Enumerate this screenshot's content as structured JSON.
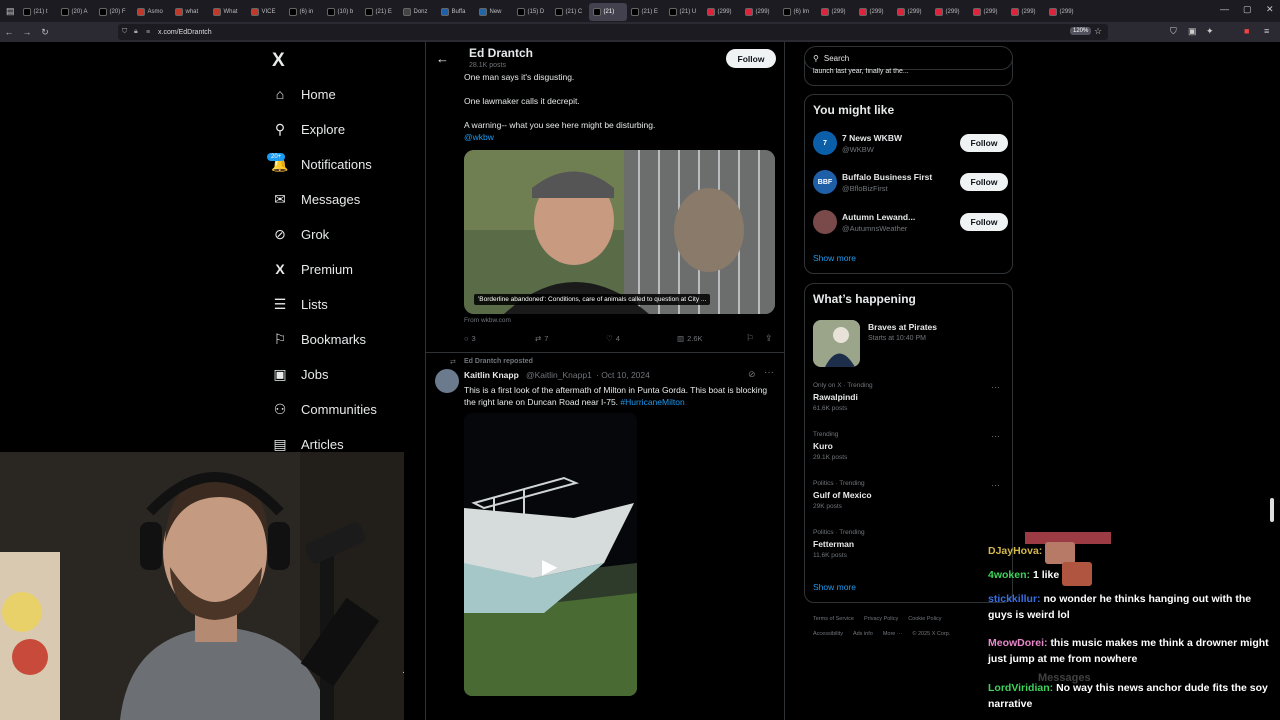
{
  "browser": {
    "tabs": [
      {
        "label": "(21) t",
        "favicon": "x"
      },
      {
        "label": "(20) A",
        "favicon": "x"
      },
      {
        "label": "(20) F",
        "favicon": "x"
      },
      {
        "label": "Asmo",
        "favicon": "o"
      },
      {
        "label": "what",
        "favicon": "o"
      },
      {
        "label": "What",
        "favicon": "o"
      },
      {
        "label": "VICE",
        "favicon": "v"
      },
      {
        "label": "(6) in",
        "favicon": "x"
      },
      {
        "label": "(10) b",
        "favicon": "x"
      },
      {
        "label": "(21) E",
        "favicon": "x"
      },
      {
        "label": "Donz",
        "favicon": "d"
      },
      {
        "label": "Buffa",
        "favicon": "b"
      },
      {
        "label": "New",
        "favicon": "n"
      },
      {
        "label": "(15) D",
        "favicon": "x"
      },
      {
        "label": "(21) C",
        "favicon": "x"
      },
      {
        "label": "(21)",
        "favicon": "x"
      },
      {
        "label": "(21) E",
        "favicon": "x"
      },
      {
        "label": "(21) U",
        "favicon": "x"
      },
      {
        "label": "(299)",
        "favicon": "y"
      },
      {
        "label": "(299)",
        "favicon": "y"
      },
      {
        "label": "(6) Im",
        "favicon": "x"
      },
      {
        "label": "(299)",
        "favicon": "y"
      },
      {
        "label": "(299)",
        "favicon": "y"
      },
      {
        "label": "(299)",
        "favicon": "y"
      },
      {
        "label": "(299)",
        "favicon": "y"
      },
      {
        "label": "(299)",
        "favicon": "y"
      },
      {
        "label": "(299)",
        "favicon": "y"
      },
      {
        "label": "(299)",
        "favicon": "y"
      }
    ],
    "url": "x.com/EdDrantch",
    "zoom": "120%"
  },
  "nav": {
    "items": [
      {
        "label": "Home",
        "icon": "home-icon",
        "glyph": "⌂"
      },
      {
        "label": "Explore",
        "icon": "search-icon",
        "glyph": "⚲"
      },
      {
        "label": "Notifications",
        "icon": "bell-icon",
        "glyph": "🔔"
      },
      {
        "label": "Messages",
        "icon": "mail-icon",
        "glyph": "✉"
      },
      {
        "label": "Grok",
        "icon": "grok-icon",
        "glyph": "⊘"
      },
      {
        "label": "Premium",
        "icon": "x-logo-icon",
        "glyph": "X"
      },
      {
        "label": "Lists",
        "icon": "list-icon",
        "glyph": "☰"
      },
      {
        "label": "Bookmarks",
        "icon": "bookmark-icon",
        "glyph": "⚐"
      },
      {
        "label": "Jobs",
        "icon": "briefcase-icon",
        "glyph": "▣"
      },
      {
        "label": "Communities",
        "icon": "people-icon",
        "glyph": "⚇"
      },
      {
        "label": "Articles",
        "icon": "article-icon",
        "glyph": "▤"
      }
    ],
    "notif_badge": "20+"
  },
  "profile": {
    "name": "Ed Drantch",
    "posts": "28.1K posts",
    "follow": "Follow"
  },
  "tweet1": {
    "lines": [
      "One man says it's disgusting.",
      "One lawmaker calls it decrepit.",
      "A warning-- what you see here might be disturbing."
    ],
    "mention": "@wkbw",
    "caption": "'Borderline abandoned': Conditions, care of animals called to question at City ...",
    "source": "From wkbw.com",
    "replies": "3",
    "reposts": "7",
    "likes": "4",
    "views": "2.6K"
  },
  "tweet2": {
    "repost_label": "Ed Drantch reposted",
    "author": "Kaitlin Knapp",
    "handle": "@Kaitlin_Knapp1",
    "date": "· Oct 10, 2024",
    "text": "This is a first look of the aftermath of Milton in Punta Gorda. This boat is blocking the right lane on Duncan Road near I-75.",
    "hashtag": "#HurricaneMilton"
  },
  "right": {
    "search_placeholder": "Search",
    "cut_text": "launch last year, finally at the...",
    "you_might_like": "You might like",
    "suggestions": [
      {
        "name": "7 News WKBW",
        "handle": "@WKBW",
        "button": "Follow",
        "avatar_text": "7",
        "avatar_color": "#0b5ea8"
      },
      {
        "name": "Buffalo Business First",
        "handle": "@BfloBizFirst",
        "button": "Follow",
        "avatar_text": "BBF",
        "avatar_color": "#1f5fa8"
      },
      {
        "name": "Autumn Lewand...",
        "handle": "@AutumnsWeather",
        "button": "Follow",
        "avatar_text": "",
        "avatar_color": "#7a4a4a"
      }
    ],
    "show_more": "Show more",
    "whats_happening": "What’s happening",
    "event": {
      "title": "Braves at Pirates",
      "time": "Starts at 10:40 PM"
    },
    "trends": [
      {
        "context": "Only on X · Trending",
        "name": "Rawalpindi",
        "count": "61.6K posts"
      },
      {
        "context": "Trending",
        "name": "Kuro",
        "count": "29.1K posts"
      },
      {
        "context": "Politics · Trending",
        "name": "Gulf of Mexico",
        "count": "29K posts"
      },
      {
        "context": "Politics · Trending",
        "name": "Fetterman",
        "count": "11.6K posts"
      }
    ],
    "show_more2": "Show more",
    "footer1": [
      "Terms of Service",
      "Privacy Policy",
      "Cookie Policy"
    ],
    "footer2": [
      "Accessibility",
      "Ads info",
      "More ···",
      "© 2025 X Corp."
    ]
  },
  "chat": {
    "messages": [
      {
        "user": "DJayHova:",
        "text": "",
        "color": "#d4b84a"
      },
      {
        "user": "4woken:",
        "text": "1 like",
        "color": "#3fd35a"
      },
      {
        "user": "stickkillur:",
        "text": "no wonder he thinks hanging out with the guys is weird lol",
        "color": "#3a6fe0"
      },
      {
        "user": "MeowDorei:",
        "text": "this music makes me think a drowner might just jump at me from nowhere",
        "color": "#e88acb"
      },
      {
        "user": "LordViridian:",
        "text": "No way this news anchor dude fits the soy narrative",
        "color": "#3fd35a"
      }
    ],
    "overlay": "Messages"
  }
}
